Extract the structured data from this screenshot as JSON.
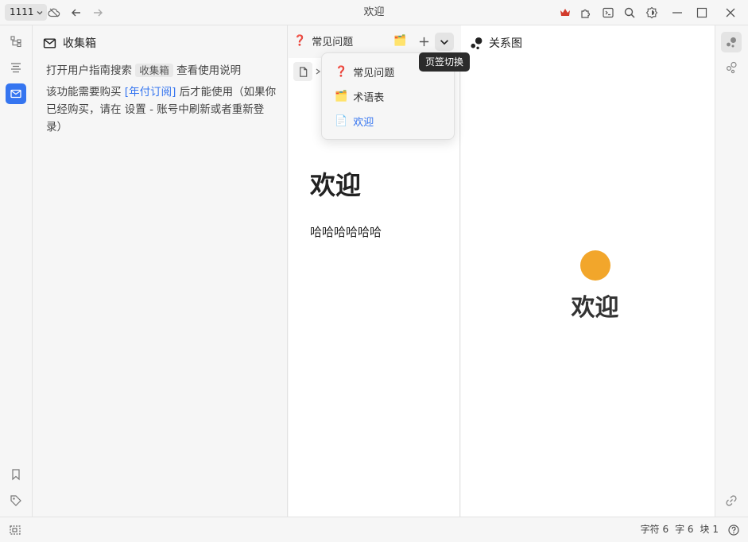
{
  "titlebar": {
    "workspace": "1111",
    "title": "欢迎",
    "icons": [
      "cloud-off-icon",
      "back-arrow-icon",
      "forward-arrow-icon",
      "crown-icon",
      "plugin-icon",
      "terminal-icon",
      "search-icon",
      "theme-mode-icon",
      "minimize-icon",
      "maximize-icon",
      "close-icon"
    ],
    "accent_crown": "#d23a2b"
  },
  "left_dock": {
    "items": [
      "file-tree-icon",
      "outline-icon",
      "inbox-icon",
      "bookmark-icon",
      "tag-icon"
    ],
    "active_color": "#3575f0"
  },
  "inbox": {
    "title": "收集箱",
    "line1_prefix": "打开用户指南搜索",
    "line1_chip": "收集箱",
    "line1_suffix": "查看使用说明",
    "line2_prefix": "该功能需要购买",
    "line2_link": "[年付订阅]",
    "line2_suffix": "后才能使用（如果你已经购买，请在 设置 - 账号中刷新或者重新登录）"
  },
  "editor": {
    "active_tab_emoji": "❓",
    "active_tab_label": "常见问题",
    "second_tab_emoji": "🗂️",
    "doc_title": "欢迎",
    "doc_paragraph": "哈哈哈哈哈哈"
  },
  "tooltip": {
    "text": "页签切换"
  },
  "tab_dropdown": {
    "items": [
      {
        "emoji": "❓",
        "label": "常见问题"
      },
      {
        "emoji": "🗂️",
        "label": "术语表"
      },
      {
        "emoji": "📄",
        "label": "欢迎"
      }
    ],
    "current_color": "#3575f0"
  },
  "graph": {
    "title": "关系图",
    "node_label": "欢迎",
    "node_color": "#f2a62b"
  },
  "right_dock": {
    "items": [
      "graph-icon",
      "global-graph-icon",
      "backlink-icon"
    ]
  },
  "statusbar": {
    "chars": "字符 6",
    "words": "字 6",
    "blocks": "块 1"
  }
}
